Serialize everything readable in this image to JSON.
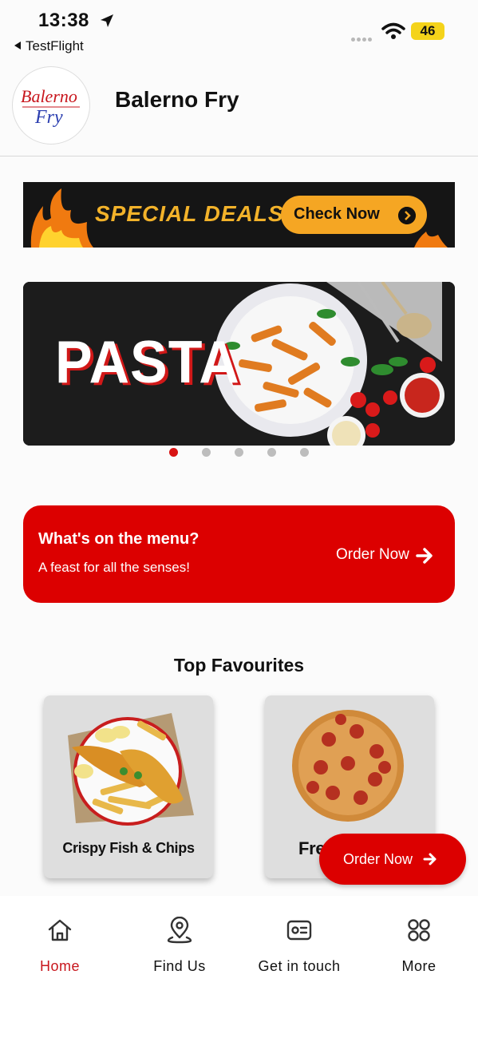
{
  "status_bar": {
    "time": "13:38",
    "back_app": "TestFlight",
    "battery": "46"
  },
  "header": {
    "title": "Balerno Fry",
    "logo_text_top": "Balerno",
    "logo_text_bottom": "Fry"
  },
  "deals_banner": {
    "title": "SPECIAL DEALS",
    "button_label": "Check Now"
  },
  "carousel": {
    "slide_text": "PASTA",
    "slide_count": 5,
    "active_index": 0
  },
  "menu_card": {
    "title": "What's on the menu?",
    "subtitle": "A feast for all the senses!",
    "action_label": "Order Now"
  },
  "favourites": {
    "title": "Top Favourites",
    "items": [
      {
        "name": "Crispy Fish & Chips"
      },
      {
        "name": "Fre"
      }
    ]
  },
  "fab": {
    "label": "Order Now"
  },
  "bottom_nav": {
    "items": [
      {
        "label": "Home",
        "icon": "home-icon",
        "active": true
      },
      {
        "label": "Find Us",
        "icon": "location-icon",
        "active": false
      },
      {
        "label": "Get in touch",
        "icon": "contact-card-icon",
        "active": false
      },
      {
        "label": "More",
        "icon": "grid-icon",
        "active": false
      }
    ]
  },
  "colors": {
    "accent_red": "#dc0000",
    "active_nav": "#c8161d",
    "deal_orange": "#f5a623",
    "battery_yellow": "#f4d31a"
  }
}
